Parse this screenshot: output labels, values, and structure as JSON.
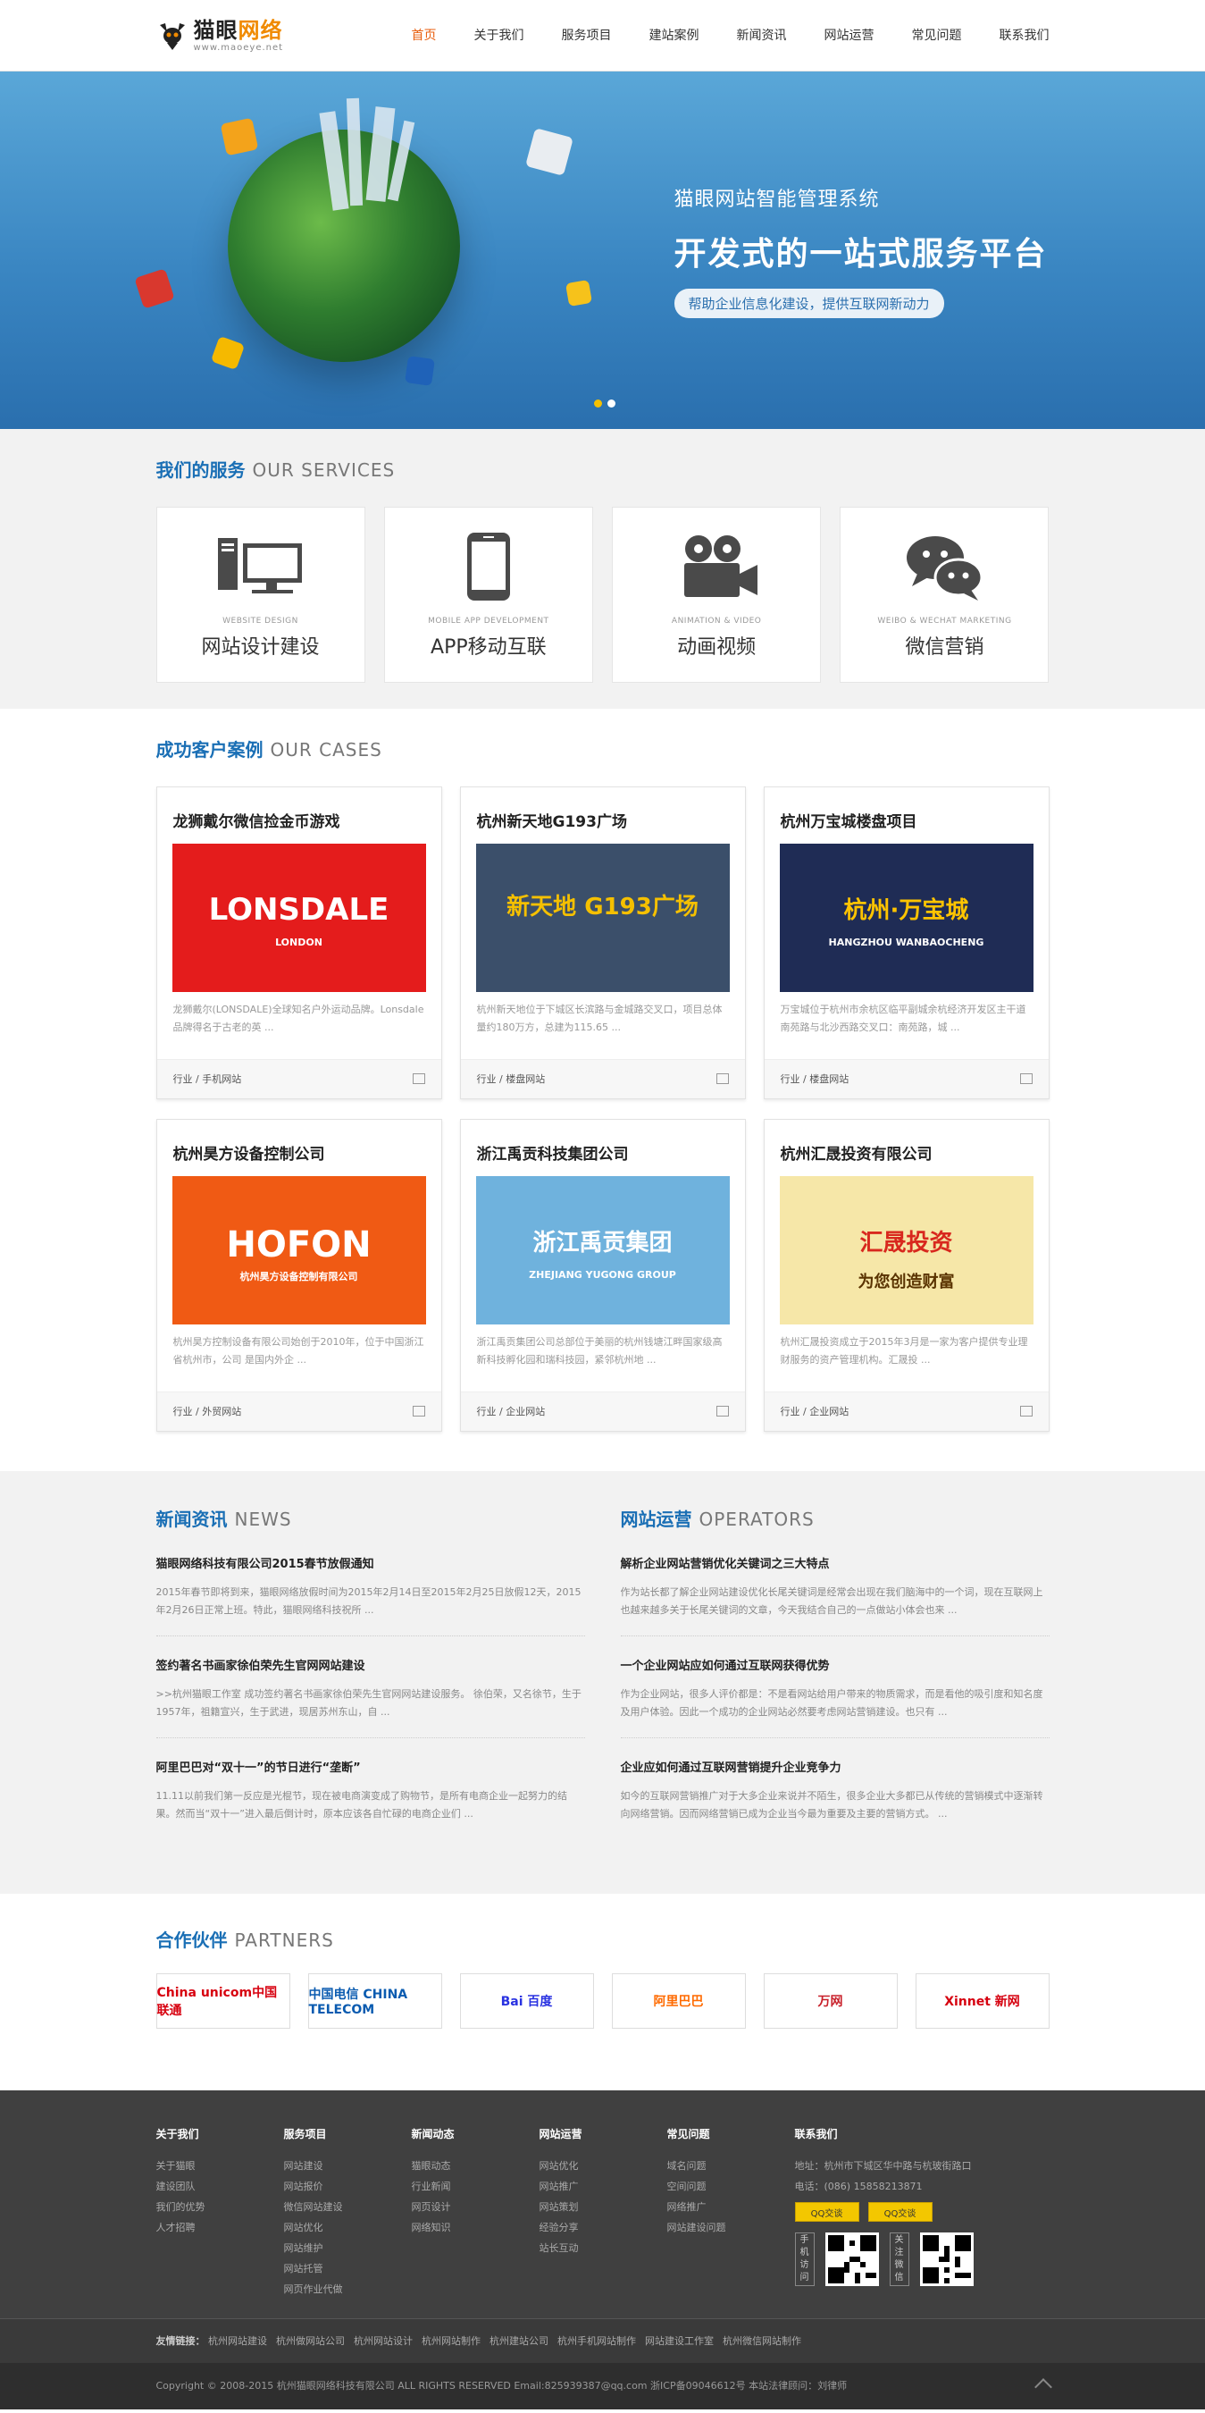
{
  "header": {
    "logo_cn_a": "猫眼",
    "logo_cn_b": "网络",
    "logo_en": "www.maoeye.net",
    "nav": [
      "首页",
      "关于我们",
      "服务项目",
      "建站案例",
      "新闻资讯",
      "网站运营",
      "常见问题",
      "联系我们"
    ],
    "active_index": 0
  },
  "banner": {
    "line1": "猫眼网站智能管理系统",
    "line2": "开发式的一站式服务平台",
    "pill": "帮助企业信息化建设，提供互联网新动力",
    "slide_count": 2,
    "active_slide": 0
  },
  "services": {
    "title_cn": "我们的服务",
    "title_en": "OUR SERVICES",
    "items": [
      {
        "en": "WEBSITE DESIGN",
        "cn": "网站设计建设",
        "icon": "computer-icon"
      },
      {
        "en": "MOBILE APP DEVELOPMENT",
        "cn": "APP移动互联",
        "icon": "phone-icon"
      },
      {
        "en": "ANIMATION & VIDEO",
        "cn": "动画视频",
        "icon": "camera-icon"
      },
      {
        "en": "WEIBO & WECHAT MARKETING",
        "cn": "微信营销",
        "icon": "chat-icon"
      }
    ]
  },
  "cases": {
    "title_cn": "成功客户案例",
    "title_en": "OUR CASES",
    "items": [
      {
        "title": "龙狮戴尔微信捡金币游戏",
        "desc": "龙狮戴尔(LONSDALE)全球知名户外运动品牌。Lonsdale品牌得名于古老的英 ...",
        "tag": "行业 / 手机网站",
        "img_text": "LONSDALE",
        "img_sub": "LONDON",
        "bg": "#e41c1c"
      },
      {
        "title": "杭州新天地G193广场",
        "desc": "杭州新天地位于下城区长滨路与金城路交叉口，项目总体量约180万方，总建为115.65 ...",
        "tag": "行业 / 楼盘网站",
        "img_text": "新天地 G193广场",
        "img_sub": "",
        "bg": "#3b4f6a"
      },
      {
        "title": "杭州万宝城楼盘项目",
        "desc": "万宝城位于杭州市余杭区临平副城余杭经济开发区主干道南苑路与北沙西路交叉口：南苑路，城 ...",
        "tag": "行业 / 楼盘网站",
        "img_text": "杭州·万宝城",
        "img_sub": "HANGZHOU WANBAOCHENG",
        "bg": "#1f2c55"
      },
      {
        "title": "杭州昊方设备控制公司",
        "desc": "杭州昊方控制设备有限公司始创于2010年，位于中国浙江省杭州市，公司 是国内外企 ...",
        "tag": "行业 / 外贸网站",
        "img_text": "HOFON",
        "img_sub": "杭州昊方设备控制有限公司",
        "bg": "#f05a14"
      },
      {
        "title": "浙江禹贡科技集团公司",
        "desc": "浙江禹贡集团公司总部位于美丽的杭州钱塘江畔国家级高新科技孵化园和瑞科技园，紧邻杭州地 ...",
        "tag": "行业 / 企业网站",
        "img_text": "浙江禹贡集团",
        "img_sub": "ZHEJIANG YUGONG GROUP",
        "bg": "#6fb2dd"
      },
      {
        "title": "杭州汇晟投资有限公司",
        "desc": "杭州汇晟投资成立于2015年3月是一家为客户提供专业理财服务的资产管理机构。汇晟投 ...",
        "tag": "行业 / 企业网站",
        "img_text": "汇晟投资",
        "img_sub": "为您创造财富",
        "bg": "#f6e7a8"
      }
    ]
  },
  "news": {
    "title_cn": "新闻资讯",
    "title_en": "NEWS",
    "items": [
      {
        "h": "猫眼网络科技有限公司2015春节放假通知",
        "p": "2015年春节即将到来，猫眼网络放假时间为2015年2月14日至2015年2月25日放假12天，2015年2月26日正常上班。特此，猫眼网络科技祝所 ..."
      },
      {
        "h": "签约著名书画家徐伯荣先生官网网站建设",
        "p": ">>杭州猫眼工作室 成功签约著名书画家徐伯荣先生官网网站建设服务。 徐伯荣，又名徐节，生于1957年，祖籍宣兴，生于武进，现居苏州东山，自 ..."
      },
      {
        "h": "阿里巴巴对“双十一”的节日进行“垄断”",
        "p": "11.11以前我们第一反应是光棍节，现在被电商演变成了购物节，是所有电商企业一起努力的结果。然而当“双十一”进入最后倒计时，原本应该各自忙碌的电商企业们 ..."
      }
    ]
  },
  "ops": {
    "title_cn": "网站运营",
    "title_en": "OPERATORS",
    "items": [
      {
        "h": "解析企业网站营销优化关键词之三大特点",
        "p": "作为站长都了解企业网站建设优化长尾关键词是经常会出现在我们脑海中的一个词，现在互联网上也越来越多关于长尾关键词的文章，今天我结合自己的一点做站小体会也来 ..."
      },
      {
        "h": "一个企业网站应如何通过互联网获得优势",
        "p": "作为企业网站，很多人评价都是：不是看网站给用户带来的物质需求，而是看他的吸引度和知名度及用户体验。因此一个成功的企业网站必然要考虑网站营销建设。也只有 ..."
      },
      {
        "h": "企业应如何通过互联网营销提升企业竞争力",
        "p": "如今的互联网营销推广对于大多企业来说并不陌生，很多企业大多都已从传统的营销模式中逐渐转向网络营销。因而网络营销已成为企业当今最为重要及主要的营销方式。 ..."
      }
    ]
  },
  "partners": {
    "title_cn": "合作伙伴",
    "title_en": "PARTNERS",
    "items": [
      {
        "name": "China unicom中国联通",
        "color": "#d7000f"
      },
      {
        "name": "中国电信 CHINA TELECOM",
        "color": "#0a5bb0"
      },
      {
        "name": "Bai 百度",
        "color": "#2932e1"
      },
      {
        "name": "阿里巴巴",
        "color": "#ff6a00"
      },
      {
        "name": "万网",
        "color": "#c8202a"
      },
      {
        "name": "Xinnet 新网",
        "color": "#d6000f"
      }
    ]
  },
  "footer": {
    "cols": [
      {
        "h": "关于我们",
        "links": [
          "关于猫眼",
          "建设团队",
          "我们的优势",
          "人才招聘"
        ]
      },
      {
        "h": "服务项目",
        "links": [
          "网站建设",
          "网站报价",
          "微信网站建设",
          "网站优化",
          "网站维护",
          "网站托管",
          "网页作业代做"
        ]
      },
      {
        "h": "新闻动态",
        "links": [
          "猫眼动态",
          "行业新闻",
          "网页设计",
          "网络知识"
        ]
      },
      {
        "h": "网站运营",
        "links": [
          "网站优化",
          "网站推广",
          "网站策划",
          "经验分享",
          "站长互动"
        ]
      },
      {
        "h": "常见问题",
        "links": [
          "域名问题",
          "空间问题",
          "网络推广",
          "网站建设问题"
        ]
      }
    ],
    "contact_h": "联系我们",
    "address": "地址：杭州市下城区华中路与杭玻街路口",
    "phone": "电话：(086) 15858213871",
    "qq_label": "QQ交谈",
    "qr1_label": "手机访问",
    "qr2_label": "关注微信"
  },
  "links": {
    "label": "友情链接：",
    "items": [
      "杭州网站建设",
      "杭州做网站公司",
      "杭州网站设计",
      "杭州网站制作",
      "杭州建站公司",
      "杭州手机网站制作",
      "网站建设工作室",
      "杭州微信网站制作"
    ]
  },
  "copyright": "Copyright  ©  2008-2015  杭州猫眼网络科技有限公司  ALL RIGHTS RESERVED  Email:825939387@qq.com  浙ICP备09046612号  本站法律顾问：刘律师"
}
